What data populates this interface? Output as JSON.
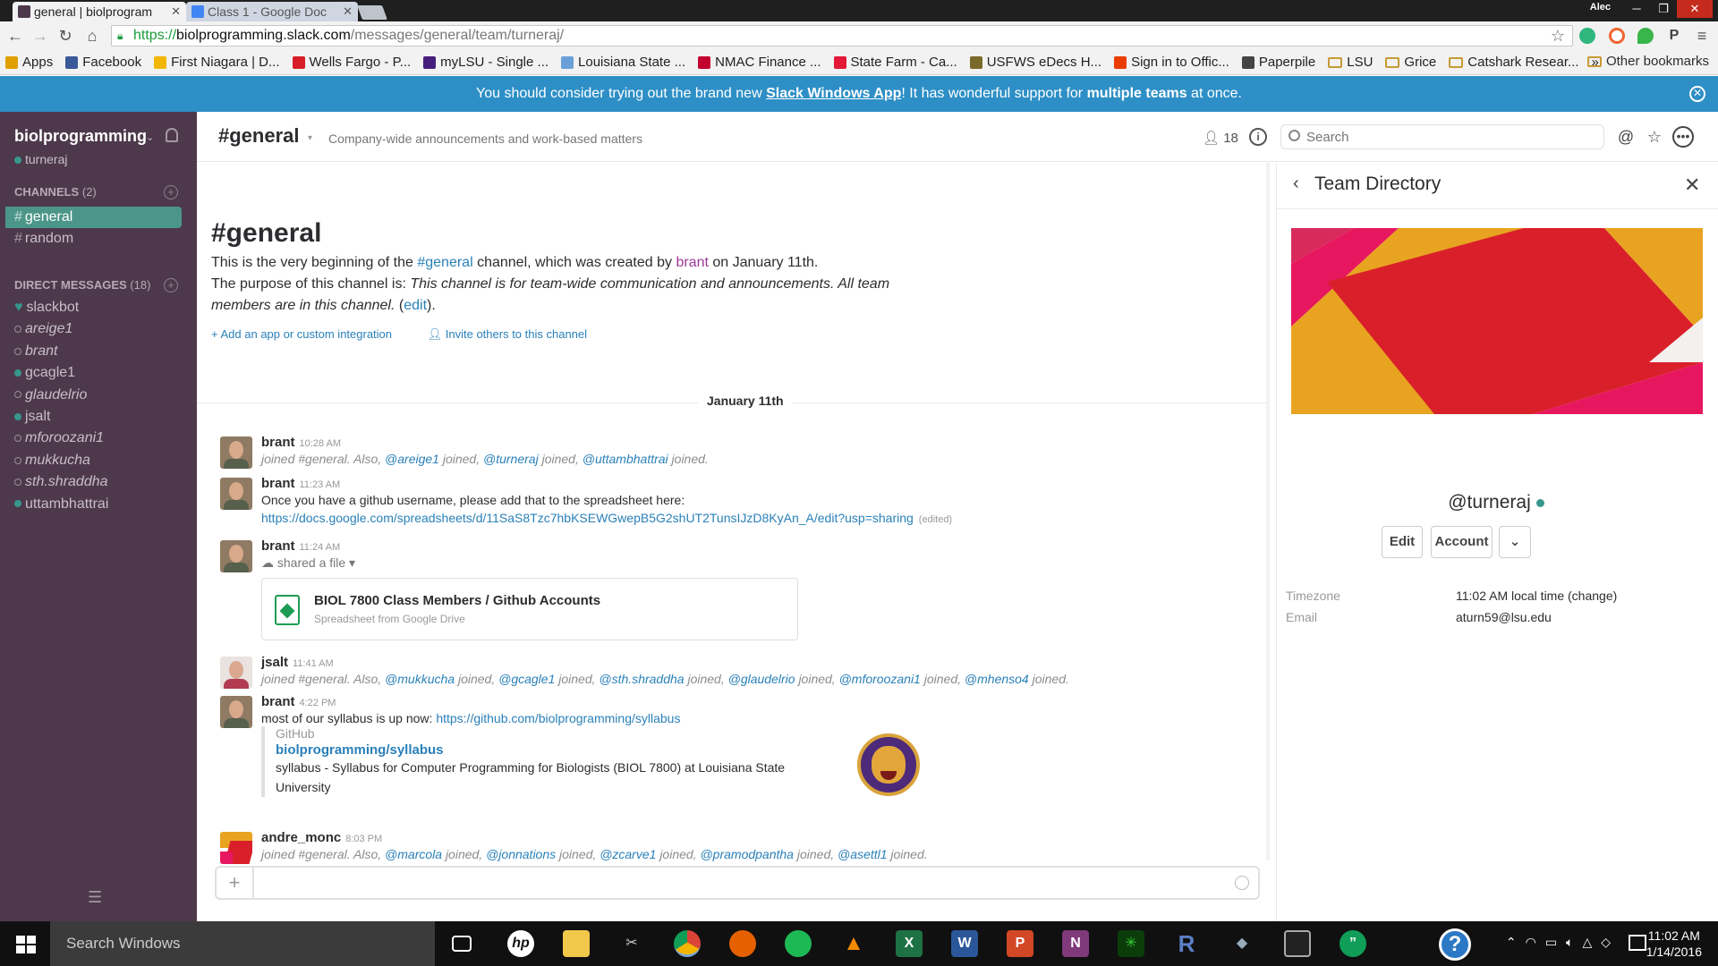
{
  "browser": {
    "tabs": [
      {
        "label": "general | biolprogram",
        "favicon_color": "#4d394b"
      },
      {
        "label": "Class 1 - Google Doc",
        "favicon_color": "#4285f4"
      }
    ],
    "window_user": "Alec",
    "url": {
      "scheme": "https://",
      "host": "biolprogramming.slack.com",
      "path": "/messages/general/team/turneraj/"
    },
    "bookmarks": [
      {
        "label": "Apps",
        "color": "#e0a000"
      },
      {
        "label": "Facebook",
        "color": "#3b5998"
      },
      {
        "label": "First Niagara | D...",
        "color": "#f2b705"
      },
      {
        "label": "Wells Fargo - P...",
        "color": "#d71e28"
      },
      {
        "label": "myLSU - Single ...",
        "color": "#461d7c"
      },
      {
        "label": "Louisiana State ...",
        "color": "#6aa0d8"
      },
      {
        "label": "NMAC Finance ...",
        "color": "#c3002f"
      },
      {
        "label": "State Farm - Ca...",
        "color": "#e31837"
      },
      {
        "label": "USFWS eDecs H...",
        "color": "#7a6a2a"
      },
      {
        "label": "Sign in to Offic...",
        "color": "#eb3c00"
      },
      {
        "label": "Paperpile",
        "color": "#444444"
      },
      {
        "label": "LSU",
        "color": "folder"
      },
      {
        "label": "Grice",
        "color": "folder"
      },
      {
        "label": "Catshark Resear...",
        "color": "folder"
      }
    ],
    "bookmarks_more": "»",
    "other_bookmarks": "Other bookmarks"
  },
  "banner": {
    "pre": "You should consider trying out the brand new ",
    "link": "Slack Windows App",
    "mid": "! It has wonderful support for ",
    "bold": "multiple teams",
    "post": " at once."
  },
  "sidebar": {
    "team_name": "biolprogramming",
    "current_user": "turneraj",
    "channels_label": "CHANNELS",
    "channels_count": "(2)",
    "channels": [
      {
        "name": "general",
        "selected": true
      },
      {
        "name": "random",
        "selected": false
      }
    ],
    "dm_label": "DIRECT MESSAGES",
    "dm_count": "(18)",
    "dms": [
      {
        "name": "slackbot",
        "status": "bot"
      },
      {
        "name": "areige1",
        "status": "away"
      },
      {
        "name": "brant",
        "status": "away"
      },
      {
        "name": "gcagle1",
        "status": "online"
      },
      {
        "name": "glaudelrio",
        "status": "away"
      },
      {
        "name": "jsalt",
        "status": "online"
      },
      {
        "name": "mforoozani1",
        "status": "away"
      },
      {
        "name": "mukkucha",
        "status": "away"
      },
      {
        "name": "sth.shraddha",
        "status": "away"
      },
      {
        "name": "uttambhattrai",
        "status": "online"
      }
    ]
  },
  "header": {
    "channel": "#general",
    "topic": "Company-wide announcements and work-based matters",
    "member_count": "18",
    "search_placeholder": "Search"
  },
  "intro": {
    "title": "#general",
    "line1_pre": "This is the very beginning of the ",
    "line1_channel": "#general",
    "line1_mid": " channel, which was created by ",
    "line1_user": "brant",
    "line1_post": " on January 11th.",
    "purpose_pre": "The purpose of this channel is: ",
    "purpose": "This channel is for team-wide communication and announcements. All team members are in this channel.",
    "edit": "edit",
    "add_app": "Add an app or custom integration",
    "invite": "Invite others to this channel"
  },
  "day_divider": "January 11th",
  "messages": [
    {
      "author": "brant",
      "time": "10:28 AM",
      "sys": "joined #general. Also, ",
      "mentions": [
        "@areige1",
        "@turneraj",
        "@uttambhattrai"
      ]
    },
    {
      "author": "brant",
      "time": "11:23 AM",
      "text": "Once you have a github username, please add that to the spreadsheet here:",
      "link": "https://docs.google.com/spreadsheets/d/11SaS8Tzc7hbKSEWGwepB5G2shUT2TunsIJzD8KyAn_A/edit?usp=sharing",
      "edited": "(edited)"
    },
    {
      "author": "brant",
      "time": "11:24 AM",
      "shared": "shared a file",
      "file_title": "BIOL 7800 Class Members / Github Accounts",
      "file_sub": "Spreadsheet from Google Drive"
    },
    {
      "author": "jsalt",
      "time": "11:41 AM",
      "sys": "joined #general. Also, ",
      "mentions": [
        "@mukkucha",
        "@gcagle1",
        "@sth.shraddha",
        "@glaudelrio",
        "@mforoozani1",
        "@mhenso4"
      ]
    },
    {
      "author": "brant",
      "time": "4:22 PM",
      "text": "most of our syllabus is up now: ",
      "link": "https://github.com/biolprogramming/syllabus",
      "att_service": "GitHub",
      "att_title": "biolprogramming/syllabus",
      "att_desc": "syllabus - Syllabus for Computer Programming for Biologists (BIOL 7800) at Louisiana State University"
    },
    {
      "author": "andre_monc",
      "time": "8:03 PM",
      "sys": "joined #general. Also, ",
      "mentions": [
        "@marcola",
        "@jonnations",
        "@zcarve1",
        "@pramodpantha",
        "@asettl1"
      ]
    }
  ],
  "joined_word": "joined.",
  "joined_sep": "joined,",
  "pane": {
    "title": "Team Directory",
    "username": "@turneraj",
    "edit": "Edit",
    "account": "Account",
    "fields": [
      {
        "key": "Timezone",
        "value": "11:02 AM local time (change)"
      },
      {
        "key": "Email",
        "value": "aturn59@lsu.edu"
      }
    ]
  },
  "taskbar": {
    "search": "Search Windows",
    "time": "11:02 AM",
    "date": "1/14/2016"
  }
}
